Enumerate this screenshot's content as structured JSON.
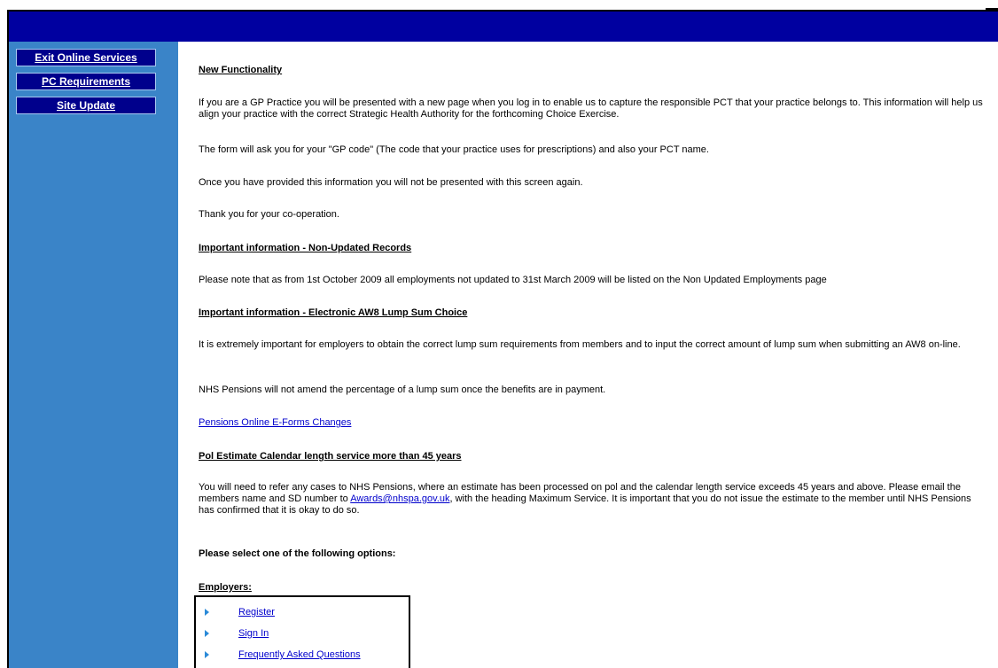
{
  "sidebar": {
    "items": [
      {
        "label": "Exit Online Services"
      },
      {
        "label": "PC Requirements"
      },
      {
        "label": "Site Update"
      }
    ]
  },
  "content": {
    "new_func_title": "New Functionality",
    "new_func_p1": "If you are a GP Practice you will be presented with a new page when you log in to enable us to capture the responsible PCT that your practice belongs to. This information will help us align your practice with the correct Strategic Health Authority for the forthcoming Choice Exercise.",
    "new_func_p2": "The form will ask you for your \"GP code\" (The code that your practice uses for prescriptions) and also your PCT name.",
    "new_func_p3": "Once you have provided this information you will not be presented with this screen again.",
    "new_func_p4": "Thank you for your co-operation.",
    "nonupdated_title": "Important information - Non-Updated Records",
    "nonupdated_p1": "Please note that as from 1st October 2009 all employments not updated to 31st March 2009 will be listed on the Non Updated Employments page",
    "aw8_title": "Important information - Electronic AW8 Lump Sum Choice",
    "aw8_p1": "It is extremely important for employers to obtain the correct lump sum requirements from members and to input the correct amount of lump sum when submitting an AW8 on-line.",
    "aw8_p2": "NHS Pensions will not amend the percentage of a lump sum once the benefits are in payment.",
    "eforms_link": "Pensions Online E-Forms Changes",
    "pol_title": "Pol Estimate Calendar length service more than 45 years",
    "pol_p1_a": "You will need to refer any cases to NHS Pensions, where an estimate has been processed on pol and the calendar length service exceeds 45 years and above. Please email the members name and SD number to ",
    "pol_email": "Awards@nhspa.gov.uk",
    "pol_p1_b": ", with the heading Maximum Service. It is important that you do not issue the estimate to the member until NHS Pensions has confirmed that it is okay to do so.",
    "select_prompt": "Please select one of the following options:",
    "employers_title": "Employers:",
    "employer_options": [
      {
        "label": "Register"
      },
      {
        "label": "Sign In"
      },
      {
        "label": "Frequently Asked Questions"
      }
    ]
  }
}
